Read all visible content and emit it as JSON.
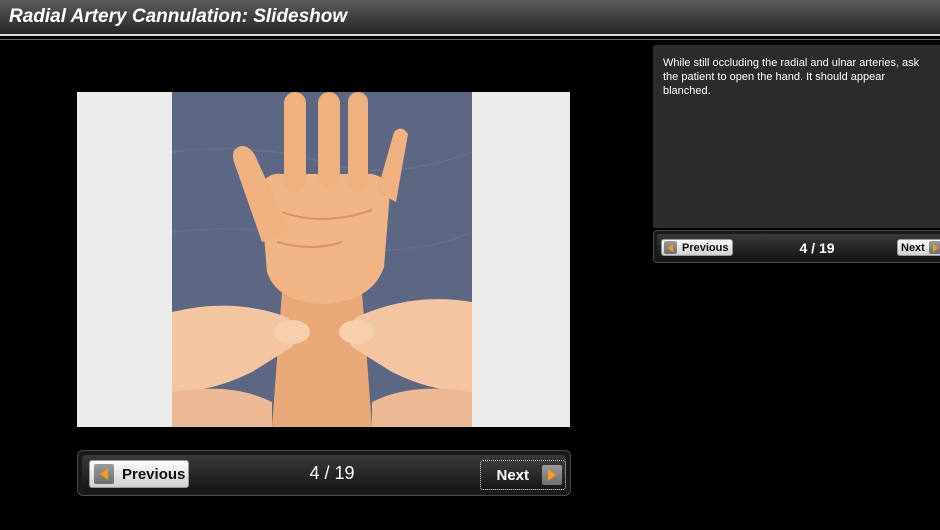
{
  "header": {
    "title": "Radial Artery Cannulation: Slideshow"
  },
  "slide": {
    "image_icon": "photo-hand-allen-test",
    "caption": "While still occluding the radial and ulnar arteries, ask the patient to open the hand. It should appear blanched."
  },
  "nav_main": {
    "previous_label": "Previous",
    "next_label": "Next",
    "counter": "4 / 19"
  },
  "nav_side": {
    "previous_label": "Previous",
    "next_label": "Next",
    "counter": "4 / 19"
  },
  "colors": {
    "background": "#000000",
    "arrow_accent": "#f59a1c",
    "panel": "#2b2b2b"
  }
}
